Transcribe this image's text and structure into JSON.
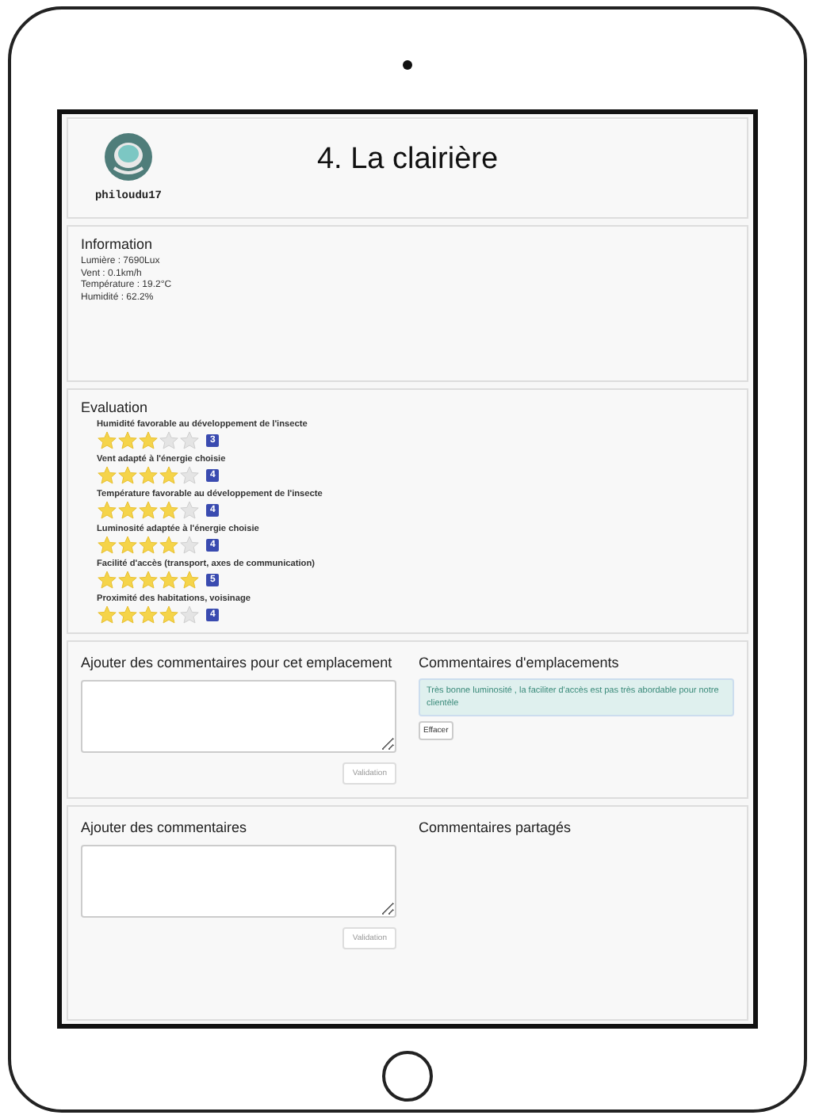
{
  "header": {
    "username": "philoudu17",
    "title": "4. La clairière"
  },
  "information": {
    "heading": "Information",
    "lines": [
      "Lumière : 7690Lux",
      "Vent : 0.1km/h",
      "Température : 19.2°C",
      "Humidité : 62.2%"
    ]
  },
  "evaluation": {
    "heading": "Evaluation",
    "criteria": [
      {
        "label": "Humidité favorable au développement de l'insecte",
        "stars": 3,
        "score": "3"
      },
      {
        "label": "Vent adapté à l'énergie choisie",
        "stars": 4,
        "score": "4"
      },
      {
        "label": "Température favorable au développement de l'insecte",
        "stars": 4,
        "score": "4"
      },
      {
        "label": "Luminosité adaptée à l'énergie choisie",
        "stars": 4,
        "score": "4"
      },
      {
        "label": "Facilité d'accès (transport, axes de communication)",
        "stars": 5,
        "score": "5"
      },
      {
        "label": "Proximité des habitations, voisinage",
        "stars": 4,
        "score": "4"
      }
    ]
  },
  "location_comments": {
    "form_heading": "Ajouter des commentaires pour cet emplacement",
    "submit": "Validation",
    "list_heading": "Commentaires d'emplacements",
    "comments": [
      "Très bonne luminosité , la faciliter d'accès est pas très abordable pour notre clientèle"
    ],
    "delete": "Effacer"
  },
  "shared_comments": {
    "form_heading": "Ajouter des commentaires",
    "submit": "Validation",
    "list_heading": "Commentaires partagés"
  }
}
